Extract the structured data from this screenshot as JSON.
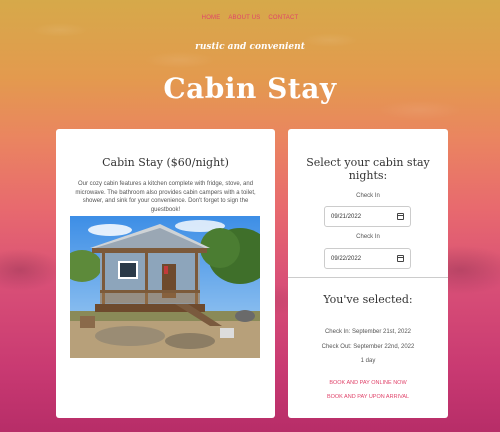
{
  "nav": {
    "items": [
      "HOME",
      "ABOUT US",
      "CONTACT"
    ]
  },
  "hero": {
    "tagline": "rustic and convenient",
    "title": "Cabin Stay"
  },
  "listing": {
    "title": "Cabin Stay ($60/night)",
    "description": "Our cozy cabin features a kitchen complete with fridge, stove, and microwave. The bathroom also provides cabin campers with a toilet, shower, and sink for your convenience. Don't forget to sign the guestbook!"
  },
  "booking": {
    "heading": "Select your cabin stay nights:",
    "check_in_label": "Check In",
    "check_in_value": "09/21/2022",
    "check_out_label": "Check In",
    "check_out_value": "09/22/2022",
    "selected_heading": "You've selected:",
    "summary_check_in": "Check In: September 21st, 2022",
    "summary_check_out": "Check Out: September 22nd, 2022",
    "summary_nights": "1 day",
    "pay_online": "BOOK AND PAY ONLINE NOW",
    "pay_arrival": "BOOK AND PAY UPON ARRIVAL"
  },
  "colors": {
    "accent": "#e0436a",
    "gradient_top": "#d6a94a",
    "gradient_bottom": "#b72d68"
  }
}
